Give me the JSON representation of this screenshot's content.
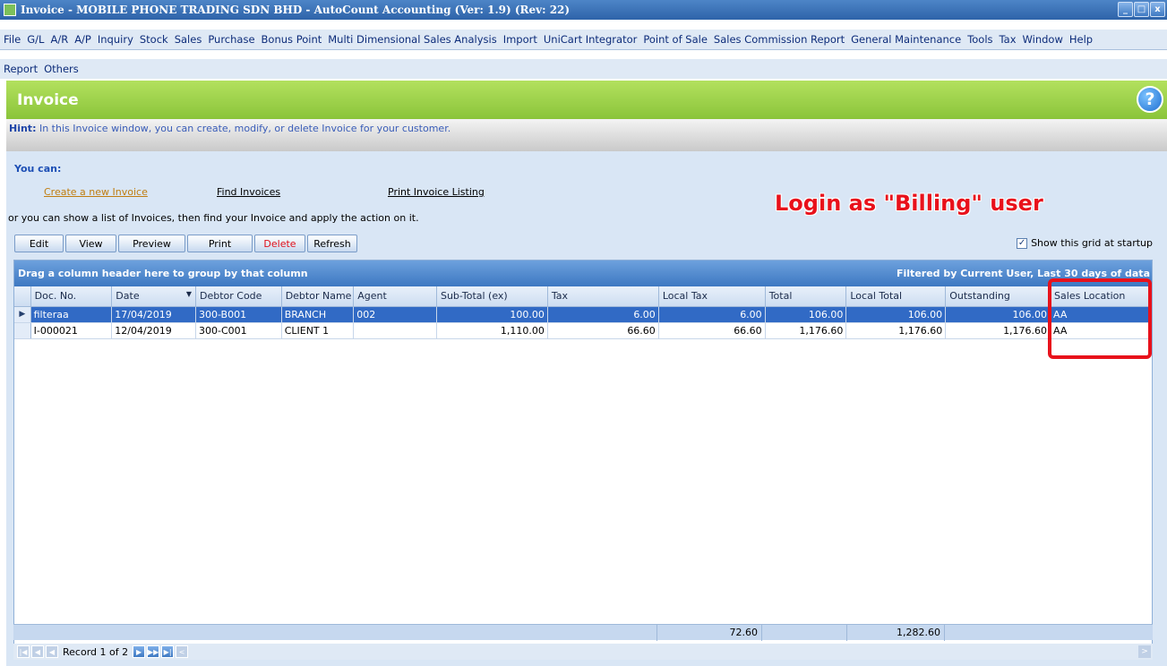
{
  "window": {
    "title": "Invoice - MOBILE PHONE TRADING SDN BHD - AutoCount Accounting (Ver: 1.9) (Rev: 22)",
    "btn_min": "_",
    "btn_max": "□",
    "btn_close": "x"
  },
  "menu_row1": [
    "File",
    "G/L",
    "A/R",
    "A/P",
    "Inquiry",
    "Stock",
    "Sales",
    "Purchase",
    "Bonus Point",
    "Multi Dimensional Sales Analysis",
    "Import",
    "UniCart Integrator",
    "Point of Sale",
    "Sales Commission Report",
    "General Maintenance",
    "Tools",
    "Tax",
    "Window",
    "Help"
  ],
  "menu_row2": [
    "Report",
    "Others"
  ],
  "header": {
    "title": "Invoice",
    "help": "?"
  },
  "hint": {
    "label": "Hint:",
    "text": " In this Invoice window, you can create, modify, or delete Invoice for your customer."
  },
  "actions": {
    "you_can": "You can:",
    "create": "Create a new Invoice",
    "find": "Find Invoices",
    "print_listing": "Print Invoice Listing",
    "or_line": "or you can show a list of Invoices, then find your Invoice and apply the action on it."
  },
  "annotation": "Login as \"Billing\" user",
  "toolbar": {
    "edit": "Edit",
    "view": "View",
    "preview": "Preview",
    "print": "Print",
    "delete": "Delete",
    "refresh": "Refresh",
    "show_startup": "Show this grid at startup",
    "checkmark": "✓"
  },
  "grid": {
    "group_panel": "Drag a column header here to group by that column",
    "filter_text": "Filtered by Current User, Last 30 days of data",
    "columns": [
      "Doc. No.",
      "Date",
      "Debtor Code",
      "Debtor Name",
      "Agent",
      "Sub-Total (ex)",
      "Tax",
      "Local Tax",
      "Total",
      "Local Total",
      "Outstanding",
      "Sales Location"
    ],
    "sort_indicator": "▼",
    "row_indicator": "▶",
    "rows": [
      [
        "filteraa",
        "17/04/2019",
        "300-B001",
        "BRANCH",
        "002",
        "100.00",
        "6.00",
        "6.00",
        "106.00",
        "106.00",
        "106.00",
        "AA"
      ],
      [
        "I-000021",
        "12/04/2019",
        "300-C001",
        "CLIENT 1",
        "",
        "1,110.00",
        "66.60",
        "66.60",
        "1,176.60",
        "1,176.60",
        "1,176.60",
        "AA"
      ]
    ],
    "footer": {
      "local_tax_sum": "72.60",
      "local_total_sum": "1,282.60"
    }
  },
  "navigator": {
    "record_text": "Record 1 of 2",
    "first": "|◀",
    "prev": "◀",
    "next": "▶",
    "next_page": "▶▶",
    "last": "▶|",
    "scroll_left": "<",
    "scroll_right": ">"
  }
}
